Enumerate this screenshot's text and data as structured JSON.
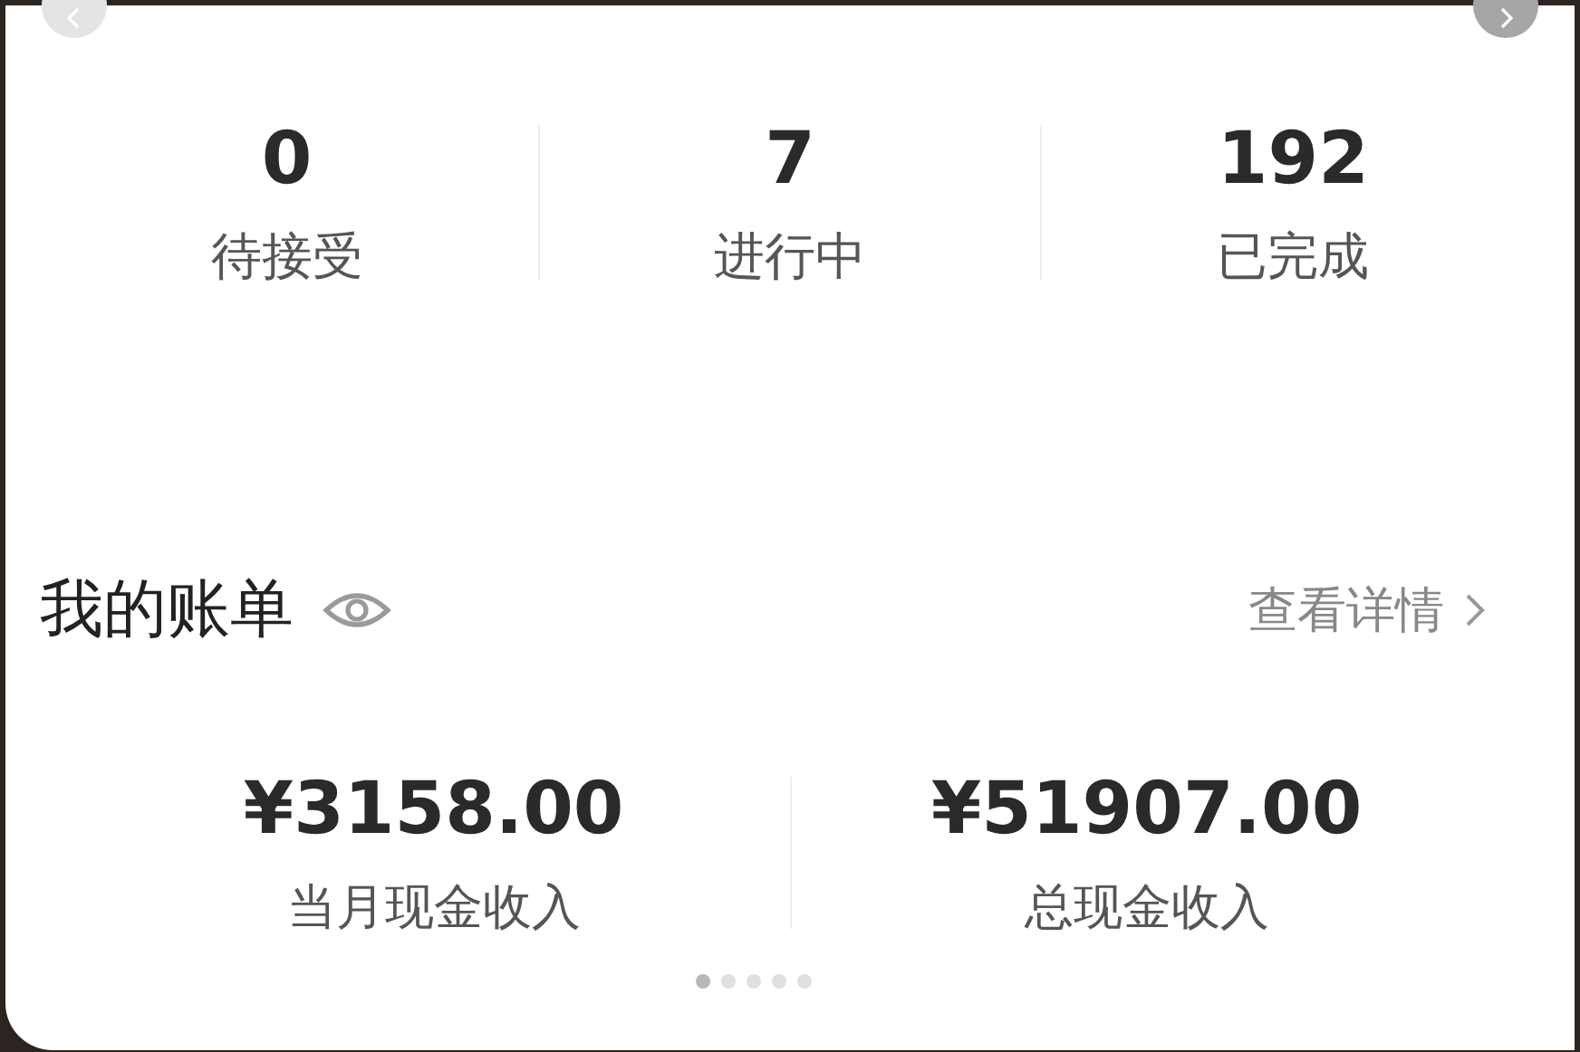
{
  "stats": [
    {
      "value": "0",
      "label": "待接受"
    },
    {
      "value": "7",
      "label": "进行中"
    },
    {
      "value": "192",
      "label": "已完成"
    }
  ],
  "bill": {
    "title": "我的账单",
    "details_link": "查看详情",
    "amounts": [
      {
        "value": "¥3158.00",
        "label": "当月现金收入"
      },
      {
        "value": "¥51907.00",
        "label": "总现金收入"
      }
    ]
  },
  "pager": [
    {
      "selected": true
    },
    {
      "selected": false
    },
    {
      "selected": false
    },
    {
      "selected": false
    },
    {
      "selected": false
    }
  ]
}
